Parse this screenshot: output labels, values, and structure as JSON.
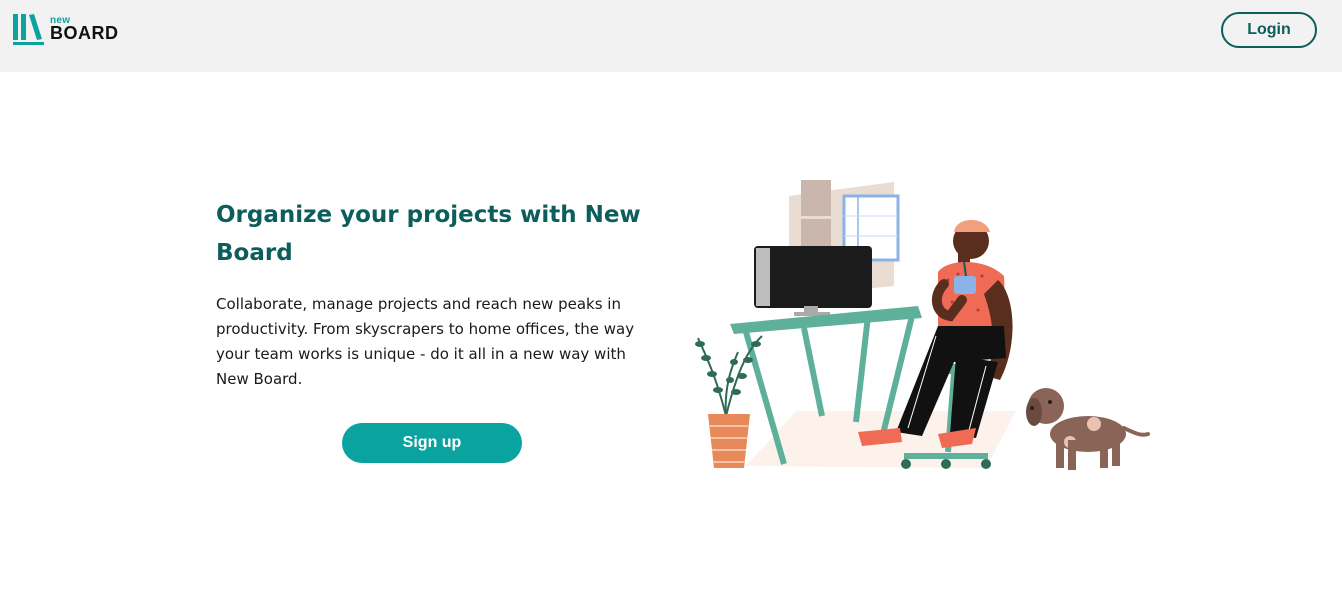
{
  "header": {
    "logo": {
      "small_text": "new",
      "big_text": "BOARD",
      "icon": "books-logo-icon"
    },
    "login_label": "Login"
  },
  "hero": {
    "title": "Organize your projects with New Board",
    "description": "Collaborate, manage projects and reach new peaks in productivity. From skyscrapers to home offices, the way your team works is unique - do it all in a new way with New Board.",
    "signup_label": "Sign up",
    "illustration_icon": "person-at-desk-with-dog-illustration"
  },
  "colors": {
    "brand_dark": "#0b5e5b",
    "brand_teal": "#0aa39f",
    "header_bg": "#f2f2f2"
  }
}
